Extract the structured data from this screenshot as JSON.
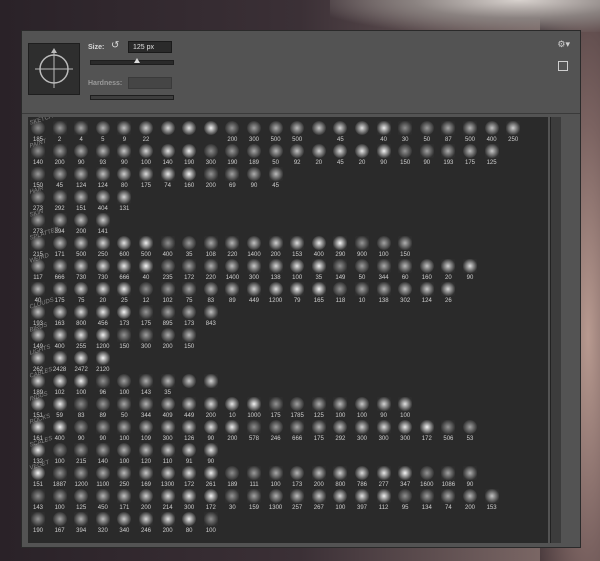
{
  "panel": {
    "size_label": "Size:",
    "size_value": "125 px",
    "hardness_label": "Hardness:"
  },
  "colors": {
    "panel": "#535353",
    "grid": "#2a2a2a",
    "text": "#cfcfcf"
  },
  "icons": [
    "crosshair-preview-icon",
    "reset-size-icon",
    "gear-icon",
    "new-preset-icon"
  ],
  "rows": [
    {
      "label": "SKETCH",
      "nums": [
        "185",
        "2",
        "4",
        "5",
        "9",
        "22",
        "",
        "",
        "",
        "200",
        "300",
        "500",
        "500",
        "",
        "45",
        "",
        "40",
        "30",
        "50",
        "87",
        "500",
        "400",
        "250"
      ]
    },
    {
      "label": "PAINT",
      "nums": [
        "140",
        "200",
        "90",
        "93",
        "90",
        "100",
        "140",
        "190",
        "300",
        "190",
        "189",
        "50",
        "92",
        "20",
        "45",
        "20",
        "90",
        "150",
        "90",
        "193",
        "175",
        "125"
      ]
    },
    {
      "label": "",
      "nums": [
        "150",
        "45",
        "124",
        "124",
        "80",
        "175",
        "74",
        "160",
        "200",
        "69",
        "90",
        "45"
      ]
    },
    {
      "label": "HAIR",
      "nums": [
        "273",
        "292",
        "151",
        "404",
        "131"
      ]
    },
    {
      "label": "SKIN",
      "nums": [
        "273",
        "394",
        "200",
        "141"
      ]
    },
    {
      "label": "SPLATTER",
      "nums": [
        "215",
        "171",
        "500",
        "250",
        "600",
        "500",
        "400",
        "35",
        "108",
        "220",
        "1400",
        "200",
        "153",
        "400",
        "290",
        "900",
        "100",
        "150"
      ]
    },
    {
      "label": "WEIRD",
      "nums": [
        "117",
        "666",
        "730",
        "730",
        "666",
        "40",
        "235",
        "172",
        "220",
        "1400",
        "300",
        "138",
        "100",
        "35",
        "149",
        "50",
        "344",
        "60",
        "160",
        "20",
        "90"
      ]
    },
    {
      "label": "",
      "nums": [
        "40",
        "175",
        "75",
        "20",
        "25",
        "12",
        "102",
        "75",
        "83",
        "89",
        "449",
        "1200",
        "79",
        "165",
        "118",
        "10",
        "138",
        "302",
        "124",
        "26"
      ]
    },
    {
      "label": "CLOUDS",
      "nums": [
        "193",
        "163",
        "800",
        "456",
        "173",
        "175",
        "895",
        "173",
        "843"
      ]
    },
    {
      "label": "BIRDS",
      "nums": [
        "149",
        "400",
        "255",
        "1200",
        "150",
        "300",
        "200",
        "150"
      ]
    },
    {
      "label": "LIGHTS",
      "nums": [
        "262",
        "2428",
        "2472",
        "2120"
      ]
    },
    {
      "label": "CABLES",
      "nums": [
        "189",
        "102",
        "100",
        "96",
        "100",
        "143",
        "35",
        "",
        ""
      ]
    },
    {
      "label": "INDUS",
      "nums": [
        "151",
        "59",
        "83",
        "89",
        "50",
        "344",
        "409",
        "449",
        "200",
        "10",
        "1000",
        "175",
        "1785",
        "125",
        "100",
        "100",
        "90",
        "100"
      ]
    },
    {
      "label": "ROCKS",
      "nums": [
        "161",
        "400",
        "90",
        "90",
        "100",
        "109",
        "300",
        "126",
        "90",
        "200",
        "578",
        "246",
        "666",
        "175",
        "292",
        "300",
        "300",
        "300",
        "172",
        "506",
        "53"
      ]
    },
    {
      "label": "SCALES",
      "nums": [
        "132",
        "100",
        "215",
        "140",
        "100",
        "120",
        "110",
        "91",
        "90"
      ]
    },
    {
      "label": "VEGET",
      "nums": [
        "151",
        "1887",
        "1200",
        "1100",
        "250",
        "169",
        "1300",
        "172",
        "261",
        "189",
        "111",
        "100",
        "173",
        "200",
        "800",
        "786",
        "277",
        "347",
        "1600",
        "1086",
        "90"
      ]
    },
    {
      "label": "",
      "nums": [
        "143",
        "100",
        "125",
        "450",
        "171",
        "200",
        "214",
        "300",
        "172",
        "30",
        "159",
        "1300",
        "257",
        "267",
        "100",
        "397",
        "112",
        "95",
        "134",
        "74",
        "200",
        "153"
      ]
    },
    {
      "label": "",
      "nums": [
        "190",
        "167",
        "394",
        "320",
        "340",
        "246",
        "200",
        "80",
        "100"
      ]
    }
  ]
}
